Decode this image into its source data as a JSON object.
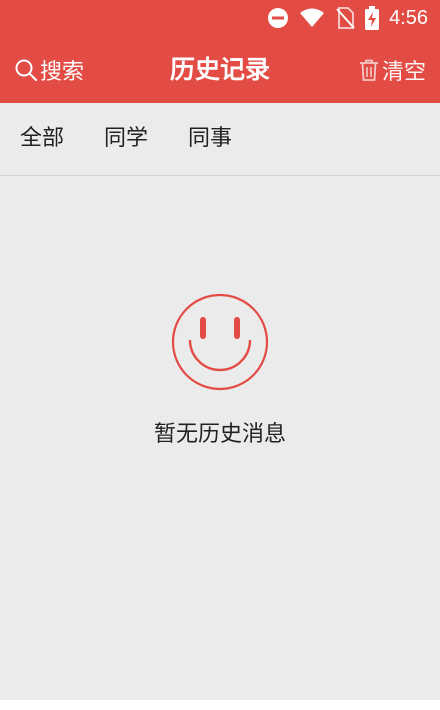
{
  "status_bar": {
    "time": "4:56",
    "icons": [
      "do-not-disturb-icon",
      "wifi-icon",
      "no-sim-icon",
      "battery-charging-icon"
    ]
  },
  "toolbar": {
    "search_label": "搜索",
    "title": "历史记录",
    "clear_label": "清空"
  },
  "tabs": [
    {
      "label": "全部"
    },
    {
      "label": "同学"
    },
    {
      "label": "同事"
    }
  ],
  "empty_state": {
    "icon": "smiley-icon",
    "message": "暂无历史消息"
  },
  "colors": {
    "header": "#e34b45",
    "background": "#ebebeb",
    "accent_icon": "#e34b45"
  }
}
